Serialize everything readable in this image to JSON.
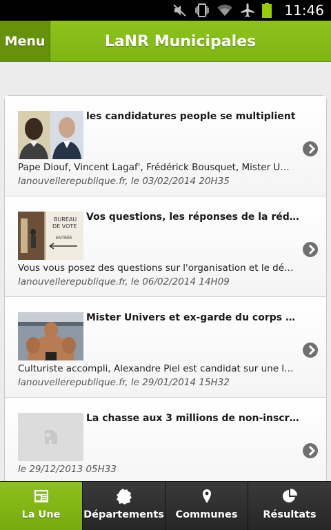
{
  "status_bar": {
    "time": "11:46",
    "icons": [
      "mute-icon",
      "vibrate-icon",
      "wifi-icon",
      "airplane-icon",
      "battery-icon"
    ],
    "battery_color": "#99cc00"
  },
  "header": {
    "menu_label": "Menu",
    "title": "LaNR Municipales",
    "accent_color": "#8dc21b"
  },
  "articles": [
    {
      "title": "les candidatures people se multiplient",
      "summary": "Pape Diouf, Vincent Lagaf', Frédérick Bousquet, Mister Univ...",
      "meta": "lanouvellerepublique.fr,  le 03/02/2014 20H35",
      "thumbnail": "portraits-photo"
    },
    {
      "title": "Vos questions, les réponses de la rédacti...",
      "summary": "Vous vous posez des questions sur l'organisation et le déro...",
      "meta": "lanouvellerepublique.fr,  le 06/02/2014 14H09",
      "thumbnail": "bureau-de-vote-photo",
      "thumbnail_text": [
        "BUREAU",
        "DE VOTE",
        "ENTRÉE"
      ]
    },
    {
      "title": "Mister Univers et ex-garde du corps de H...",
      "summary": "Culturiste accompli, Alexandre Piel est candidat sur une list...",
      "meta": "lanouvellerepublique.fr,  le 29/01/2014 15H32",
      "thumbnail": "bodybuilder-photo"
    },
    {
      "title": "La chasse aux 3 millions de non-inscrits",
      "summary": "",
      "meta": "le 29/12/2013 05H33",
      "thumbnail": "placeholder-image-icon"
    }
  ],
  "tabs": [
    {
      "label": "La Une",
      "icon": "newspaper-icon",
      "active": true
    },
    {
      "label": "Départements",
      "icon": "france-map-icon",
      "active": false
    },
    {
      "label": "Communes",
      "icon": "map-pin-icon",
      "active": false
    },
    {
      "label": "Résultats",
      "icon": "pie-chart-icon",
      "active": false
    }
  ]
}
